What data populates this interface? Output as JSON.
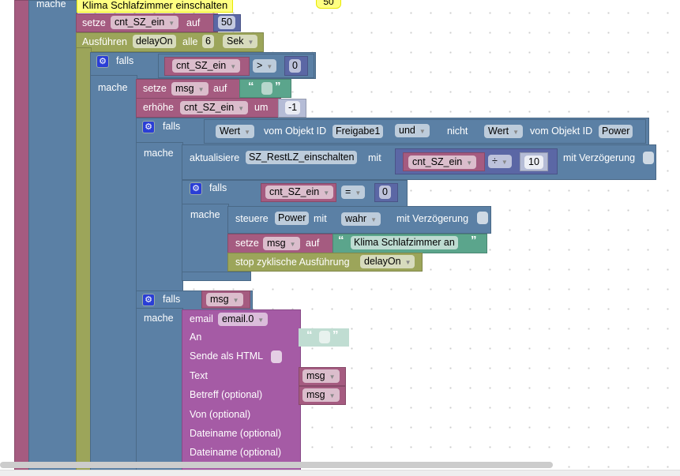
{
  "comment": "Klima Schlafzimmer einschalten",
  "bubble": "50",
  "colors": {
    "variable": "#a55b80",
    "logic": "#5b80a5",
    "timer": "#9ca55a",
    "math": "#5b67a5",
    "text": "#5ba58c",
    "email": "#a55ba5"
  },
  "outer": {
    "mache": "mache"
  },
  "set1": {
    "setze": "setze",
    "var": "cnt_SZ_ein",
    "auf": "auf",
    "value": "50"
  },
  "interval": {
    "label": "Ausführen",
    "name": "delayOn",
    "alle": "alle",
    "value": "6",
    "unit": "Sek"
  },
  "if1": {
    "falls": "falls",
    "mache": "mache",
    "var": "cnt_SZ_ein",
    "op": ">",
    "value": "0"
  },
  "set2": {
    "setze": "setze",
    "var": "msg",
    "auf": "auf",
    "open": "“",
    "close": "”"
  },
  "inc": {
    "label": "erhöhe",
    "var": "cnt_SZ_ein",
    "um": "um",
    "value": "-1"
  },
  "if2": {
    "falls": "falls",
    "mache": "mache",
    "wert1": "Wert",
    "vom1": "vom Objekt ID",
    "id1": "Freigabe1",
    "und": "und",
    "nicht": "nicht",
    "wert2": "Wert",
    "vom2": "vom Objekt ID",
    "id2": "Power"
  },
  "update": {
    "label": "aktualisiere",
    "target": "SZ_RestLZ_einschalten",
    "mit": "mit",
    "var": "cnt_SZ_ein",
    "op": "÷",
    "value": "10",
    "delay": "mit Verzögerung"
  },
  "if3": {
    "falls": "falls",
    "mache": "mache",
    "var": "cnt_SZ_ein",
    "op": "=",
    "value": "0"
  },
  "control": {
    "label": "steuere",
    "target": "Power",
    "mit": "mit",
    "value": "wahr",
    "delay": "mit Verzögerung"
  },
  "set3": {
    "setze": "setze",
    "var": "msg",
    "auf": "auf",
    "open": "“",
    "text": "Klima Schlafzimmer an",
    "close": "”"
  },
  "stop": {
    "label": "stop zyklische Ausführung",
    "name": "delayOn"
  },
  "if4": {
    "falls": "falls",
    "mache": "mache",
    "var": "msg"
  },
  "email": {
    "label": "email",
    "instance": "email.0",
    "an": "An",
    "open": "“",
    "close": "”",
    "html": "Sende als HTML",
    "text": "Text",
    "text_var": "msg",
    "betreff": "Betreff (optional)",
    "betreff_var": "msg",
    "von": "Von (optional)",
    "datei1": "Dateiname (optional)",
    "datei2": "Dateiname (optional)"
  }
}
